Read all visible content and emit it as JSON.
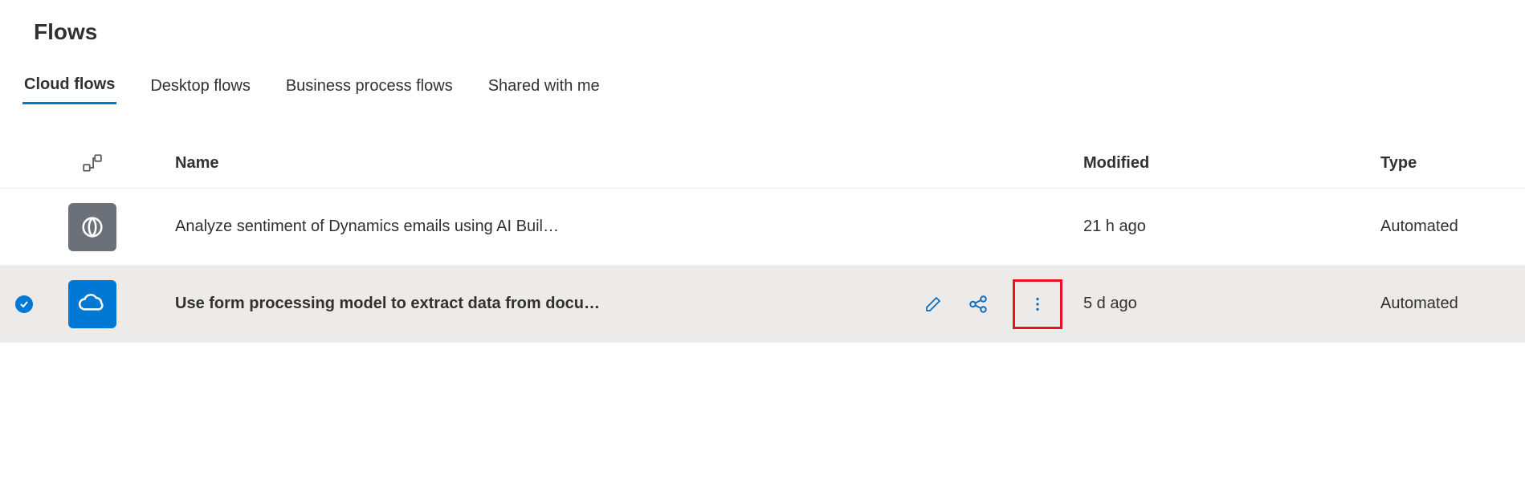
{
  "page": {
    "title": "Flows"
  },
  "tabs": {
    "items": [
      {
        "label": "Cloud flows",
        "active": true
      },
      {
        "label": "Desktop flows",
        "active": false
      },
      {
        "label": "Business process flows",
        "active": false
      },
      {
        "label": "Shared with me",
        "active": false
      }
    ]
  },
  "columns": {
    "name": "Name",
    "modified": "Modified",
    "type": "Type"
  },
  "rows": [
    {
      "selected": false,
      "icon": "data-service-icon",
      "tile_color": "gray",
      "name": "Analyze sentiment of Dynamics emails using AI Buil…",
      "modified": "21 h ago",
      "type": "Automated"
    },
    {
      "selected": true,
      "icon": "onedrive-icon",
      "tile_color": "blue",
      "name": "Use form processing model to extract data from docu…",
      "modified": "5 d ago",
      "type": "Automated"
    }
  ],
  "actions": {
    "edit": "Edit",
    "share": "Share",
    "more": "More commands"
  },
  "colors": {
    "accent": "#0078d4",
    "highlight_border": "#e81123"
  }
}
